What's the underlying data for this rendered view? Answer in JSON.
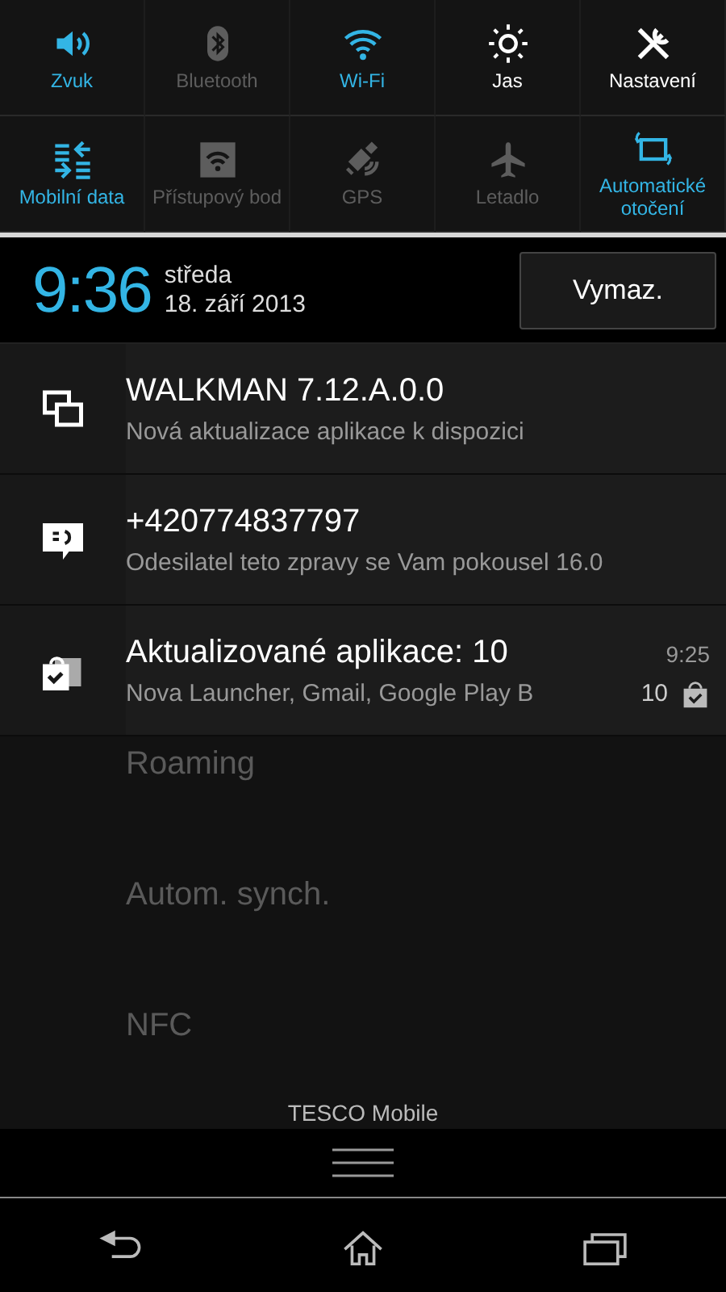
{
  "quick_settings": [
    {
      "label": "Zvuk",
      "kind": "toggle",
      "on": true
    },
    {
      "label": "Bluetooth",
      "kind": "toggle",
      "on": false
    },
    {
      "label": "Wi-Fi",
      "kind": "toggle",
      "on": true
    },
    {
      "label": "Jas",
      "kind": "shortcut"
    },
    {
      "label": "Nastavení",
      "kind": "shortcut"
    },
    {
      "label": "Mobilní data",
      "kind": "toggle",
      "on": true
    },
    {
      "label": "Přístupový bod",
      "kind": "toggle",
      "on": false
    },
    {
      "label": "GPS",
      "kind": "toggle",
      "on": false
    },
    {
      "label": "Letadlo",
      "kind": "toggle",
      "on": false
    },
    {
      "label": "Automatické otočení",
      "kind": "toggle",
      "on": true
    }
  ],
  "header": {
    "time": "9:36",
    "weekday": "středa",
    "date": "18. září 2013",
    "clear_button": "Vymaz."
  },
  "notifications": [
    {
      "title": "WALKMAN 7.12.A.0.0",
      "text": "Nová aktualizace aplikace k dispozici"
    },
    {
      "title": "+420774837797",
      "text": "Odesilatel teto zpravy se Vam pokousel 16.0"
    },
    {
      "title": "Aktualizované aplikace: 10",
      "text": "Nova Launcher, Gmail, Google Play B",
      "time": "9:25",
      "count": "10"
    }
  ],
  "background_settings": [
    "Roaming",
    "Autom. synch.",
    "NFC"
  ],
  "carrier": "TESCO Mobile"
}
